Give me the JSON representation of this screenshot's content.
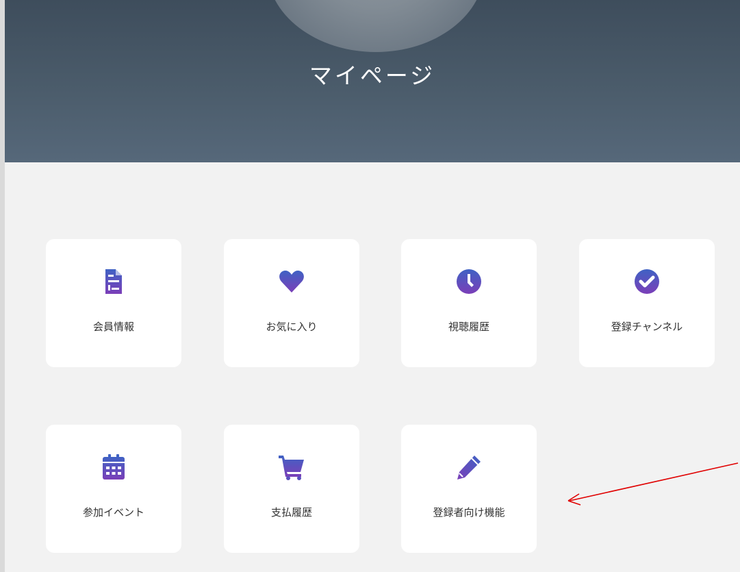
{
  "header": {
    "title": "マイページ"
  },
  "menu": {
    "items": [
      {
        "id": "member-info",
        "label": "会員情報",
        "icon": "document-icon"
      },
      {
        "id": "favorites",
        "label": "お気に入り",
        "icon": "heart-icon"
      },
      {
        "id": "watch-history",
        "label": "視聴履歴",
        "icon": "clock-icon"
      },
      {
        "id": "subscribed-channels",
        "label": "登録チャンネル",
        "icon": "check-circle-icon"
      },
      {
        "id": "joined-events",
        "label": "参加イベント",
        "icon": "calendar-icon"
      },
      {
        "id": "payment-history",
        "label": "支払履歴",
        "icon": "cart-icon"
      },
      {
        "id": "creator-features",
        "label": "登録者向け機能",
        "icon": "pencil-icon"
      }
    ]
  },
  "annotation": {
    "type": "arrow",
    "color": "#e00000",
    "points_to": "登録者向け機能"
  },
  "colors": {
    "gradient_top": "#3f62c4",
    "gradient_bottom": "#7b3fb8",
    "hero": "#4b5c6b",
    "background": "#f2f2f2"
  }
}
